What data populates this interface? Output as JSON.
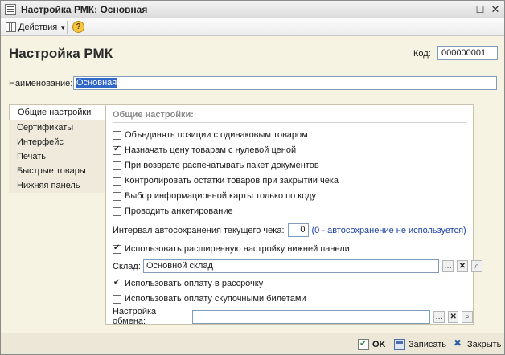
{
  "window": {
    "title": "Настройка РМК: Основная"
  },
  "toolbar": {
    "actions_label": "Действия",
    "help_label": "?"
  },
  "form": {
    "heading": "Настройка РМК",
    "code_label": "Код:",
    "code_value": "000000001",
    "name_label": "Наименование:",
    "name_value": "Основная"
  },
  "tabs": [
    {
      "label": "Общие настройки",
      "active": true
    },
    {
      "label": "Сертификаты",
      "active": false
    },
    {
      "label": "Интерфейс",
      "active": false
    },
    {
      "label": "Печать",
      "active": false
    },
    {
      "label": "Быстрые товары",
      "active": false
    },
    {
      "label": "Нижняя панель",
      "active": false
    }
  ],
  "general": {
    "title": "Общие настройки:",
    "options": [
      {
        "label": "Объединять позиции с одинаковым товаром",
        "checked": false
      },
      {
        "label": "Назначать цену товарам с нулевой ценой",
        "checked": true
      },
      {
        "label": "При возврате распечатывать пакет документов",
        "checked": false
      },
      {
        "label": "Контролировать остатки товаров при закрытии чека",
        "checked": false
      },
      {
        "label": "Выбор информационной карты только по коду",
        "checked": false
      },
      {
        "label": "Проводить анкетирование",
        "checked": false
      }
    ],
    "interval_label": "Интервал автосохранения текущего чека:",
    "interval_value": "0",
    "interval_hint": "(0 - автосохранение не используется)",
    "extended_panel": {
      "label": "Использовать расширенную настройку нижней панели",
      "checked": true
    },
    "warehouse_label": "Склад:",
    "warehouse_value": "Основной склад",
    "installments": {
      "label": "Использовать оплату в рассрочку",
      "checked": true
    },
    "buyback": {
      "label": "Использовать оплату скупочными билетами",
      "checked": false
    },
    "exchange_label": "Настройка обмена:",
    "exchange_value": ""
  },
  "footer": {
    "ok_label": "OK",
    "save_label": "Записать",
    "close_label": "Закрыть"
  }
}
